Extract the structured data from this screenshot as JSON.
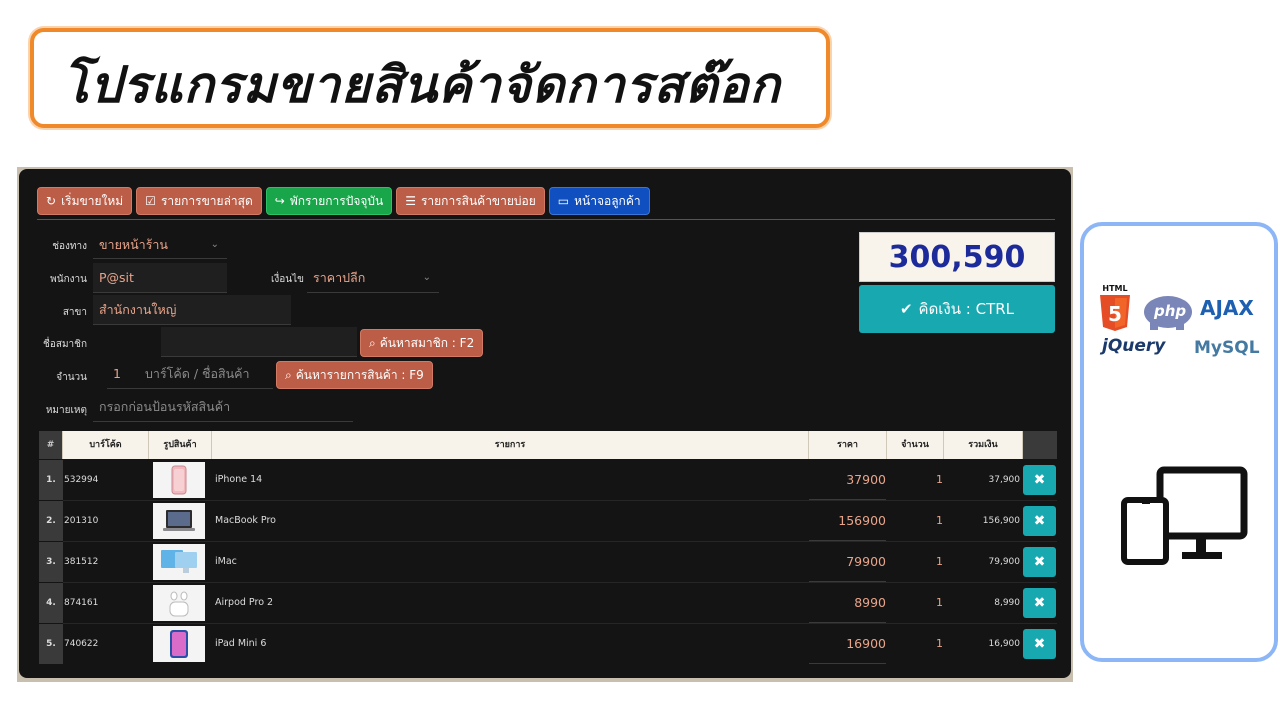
{
  "banner": {
    "title": "โปรแกรมขายสินค้าจัดการสต๊อก"
  },
  "toolbar": {
    "new_sale": "เริ่มขายใหม่",
    "recent_sales": "รายการขายล่าสุด",
    "hold_list": "พักรายการปัจจุบัน",
    "best_sellers": "รายการสินค้าขายบ่อย",
    "customer_screen": "หน้าจอลูกค้า"
  },
  "form": {
    "channel_label": "ช่องทาง",
    "channel_value": "ขายหน้าร้าน",
    "staff_label": "พนักงาน",
    "staff_value": "P@sit",
    "condition_label": "เงื่อนไข",
    "condition_value": "ราคาปลีก",
    "branch_label": "สาขา",
    "branch_value": "สำนักงานใหญ่",
    "member_label": "ชื่อสมาชิก",
    "member_value": "",
    "member_search_button": "ค้นหาสมาชิก : F2",
    "qty_label": "จำนวน",
    "qty_value": "1",
    "barcode_placeholder": "บาร์โค้ด / ชื่อสินค้า",
    "product_search_button": "ค้นหารายการสินค้า : F9",
    "note_label": "หมายเหตุ",
    "note_placeholder": "กรอกก่อนป้อนรหัสสินค้า"
  },
  "summary": {
    "total": "300,590",
    "pay_button": "คิดเงิน : CTRL"
  },
  "table": {
    "headers": {
      "num": "#",
      "barcode": "บาร์โค้ด",
      "image": "รูปสินค้า",
      "item": "รายการ",
      "price": "ราคา",
      "qty": "จำนวน",
      "sum": "รวมเงิน"
    },
    "rows": [
      {
        "num": "1.",
        "barcode": "532994",
        "name": "iPhone 14",
        "price": "37900",
        "qty": "1",
        "sum": "37,900"
      },
      {
        "num": "2.",
        "barcode": "201310",
        "name": "MacBook Pro",
        "price": "156900",
        "qty": "1",
        "sum": "156,900"
      },
      {
        "num": "3.",
        "barcode": "381512",
        "name": "iMac",
        "price": "79900",
        "qty": "1",
        "sum": "79,900"
      },
      {
        "num": "4.",
        "barcode": "874161",
        "name": "Airpod Pro 2",
        "price": "8990",
        "qty": "1",
        "sum": "8,990"
      },
      {
        "num": "5.",
        "barcode": "740622",
        "name": "iPad Mini 6",
        "price": "16900",
        "qty": "1",
        "sum": "16,900"
      }
    ]
  },
  "logos": {
    "html": "HTML",
    "php": "php",
    "ajax": "AJAX",
    "jquery": "jQuery",
    "mysql": "MySQL"
  },
  "colors": {
    "accent_orange": "#f0892a",
    "teal": "#17a8b0",
    "brick": "#bb5d47",
    "green": "#19a54a",
    "blue": "#0f4fbf",
    "total_blue": "#1d2b9a"
  }
}
